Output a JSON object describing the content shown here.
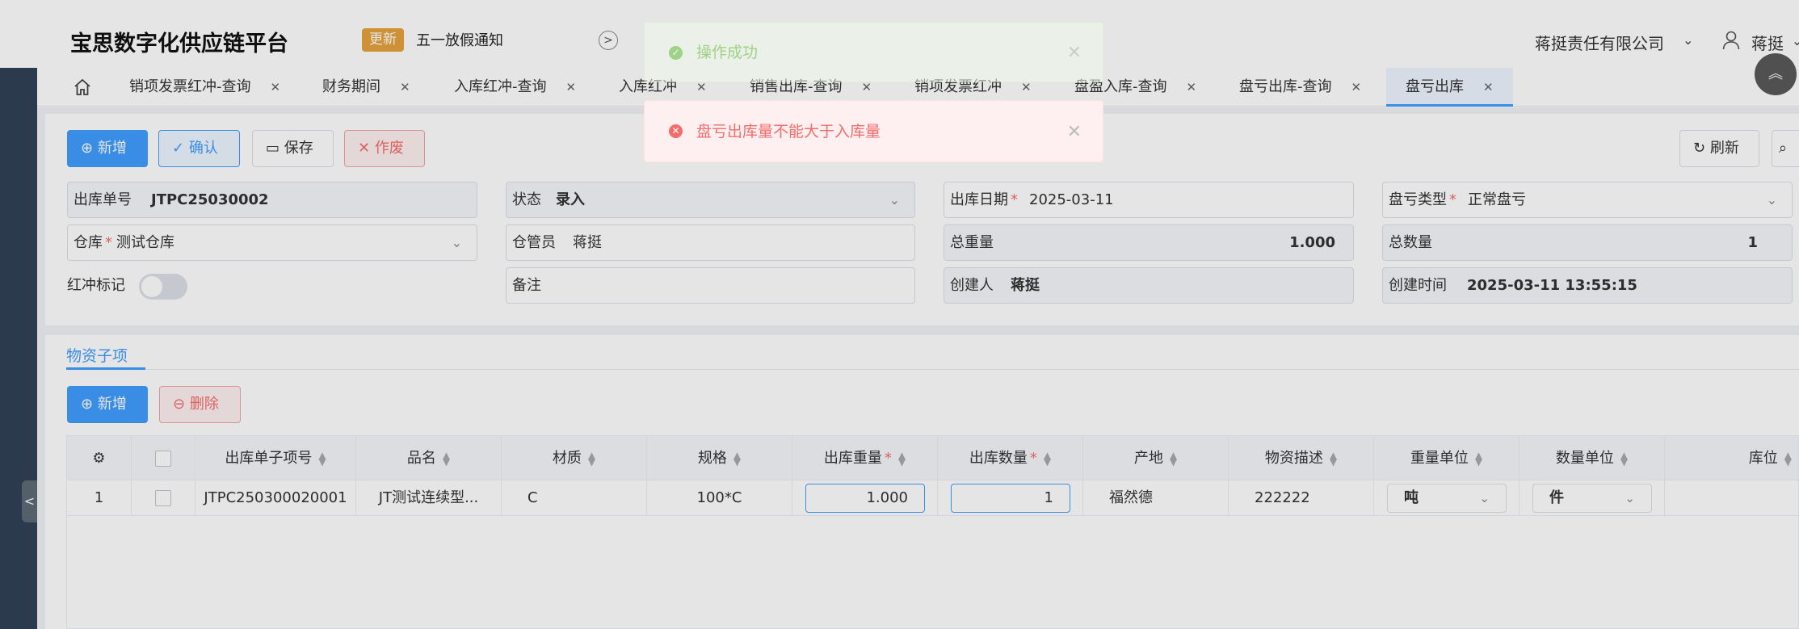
{
  "header": {
    "brand": "宝思数字化供应链平台",
    "update_badge": "更新",
    "notice": "五一放假通知",
    "company": "蒋挺责任有限公司",
    "username": "蒋挺"
  },
  "tabs": [
    {
      "label": "销项发票红冲-查询"
    },
    {
      "label": "财务期间"
    },
    {
      "label": "入库红冲-查询"
    },
    {
      "label": "入库红冲"
    },
    {
      "label": "销售出库-查询"
    },
    {
      "label": "销项发票红冲"
    },
    {
      "label": "盘盈入库-查询"
    },
    {
      "label": "盘亏出库-查询"
    },
    {
      "label": "盘亏出库",
      "active": true
    }
  ],
  "toolbar": {
    "add": "新增",
    "confirm": "确认",
    "save": "保存",
    "void": "作废",
    "refresh": "刷新"
  },
  "form": {
    "order_no_label": "出库单号",
    "order_no": "JTPC25030002",
    "status_label": "状态",
    "status": "录入",
    "out_date_label": "出库日期",
    "out_date": "2025-03-11",
    "loss_type_label": "盘亏类型",
    "loss_type": "正常盘亏",
    "warehouse_label": "仓库",
    "warehouse": "测试仓库",
    "keeper_label": "仓管员",
    "keeper": "蒋挺",
    "total_weight_label": "总重量",
    "total_weight": "1.000",
    "total_qty_label": "总数量",
    "total_qty": "1",
    "red_flag_label": "红冲标记",
    "remark_label": "备注",
    "creator_label": "创建人",
    "creator": "蒋挺",
    "created_at_label": "创建时间",
    "created_at": "2025-03-11 13:55:15"
  },
  "items_section": {
    "tab": "物资子项",
    "add": "新增",
    "delete": "删除",
    "columns": [
      "出库单子项号",
      "品名",
      "材质",
      "规格",
      "出库重量",
      "出库数量",
      "产地",
      "物资描述",
      "重量单位",
      "数量单位",
      "库位"
    ],
    "rows": [
      {
        "index": "1",
        "item_no": "JTPC250300020001",
        "name": "JT测试连续型...",
        "material": "C",
        "spec": "100*C",
        "weight": "1.000",
        "qty": "1",
        "origin": "福然德",
        "desc": "222222",
        "weight_unit": "吨",
        "qty_unit": "件",
        "location": ""
      }
    ]
  },
  "toasts": {
    "success": "操作成功",
    "error": "盘亏出库量不能大于入库量"
  },
  "colors": {
    "primary": "#409eff",
    "danger": "#f56c6c",
    "success": "#67c23a",
    "warning": "#e6a23c",
    "sidebar": "#304156"
  }
}
